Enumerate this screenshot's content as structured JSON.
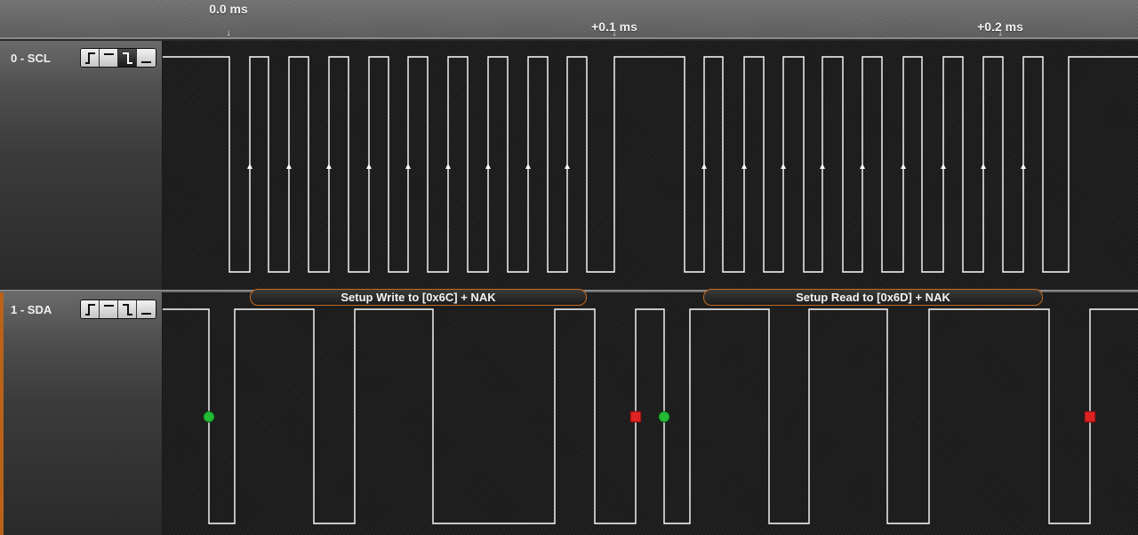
{
  "ruler": {
    "labels": [
      "0.0 ms",
      "+0.1 ms",
      "+0.2 ms"
    ],
    "tick_glyph": "↓"
  },
  "channels": [
    {
      "name": "0 - SCL",
      "trigger_buttons": [
        "rising-edge-icon",
        "high-level-icon",
        "falling-edge-icon",
        "low-level-icon"
      ],
      "active_trigger": 2
    },
    {
      "name": "1 - SDA",
      "trigger_buttons": [
        "rising-edge-icon",
        "high-level-icon",
        "falling-edge-icon",
        "low-level-icon"
      ],
      "active_trigger": -1
    }
  ],
  "protocol_frames": [
    "Setup Write to [0x6C] + NAK",
    "Setup Read to [0x6D] + NAK"
  ],
  "markers": {
    "start": "green-circle",
    "stop": "red-square"
  },
  "colors": {
    "waveform": "#ffffff",
    "start_marker": "#22bb33",
    "stop_marker": "#dd2222",
    "frame_border": "#c86a1d",
    "channel_accent": "#b8621b"
  }
}
